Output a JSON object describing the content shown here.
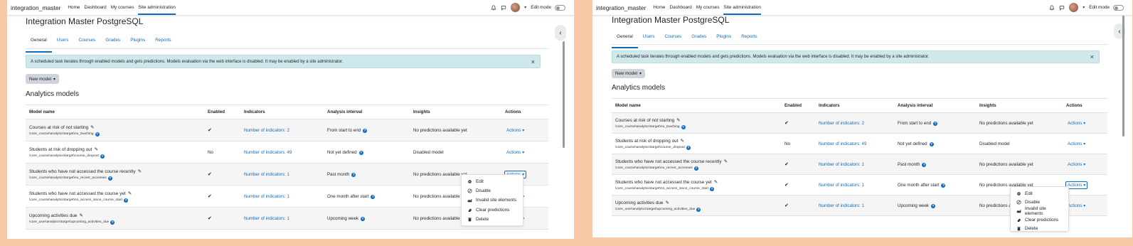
{
  "site_name": "integration_master",
  "nav": [
    "Home",
    "Dashboard",
    "My courses",
    "Site administration"
  ],
  "edit_mode_label": "Edit mode",
  "page_title": "Integration Master PostgreSQL",
  "tabs": [
    "General",
    "Users",
    "Courses",
    "Grades",
    "Plugins",
    "Reports"
  ],
  "alert_text": "A scheduled task iterates through enabled models and gets predictions. Models evaluation via the web interface is disabled. It may be enabled by a site administrator.",
  "alert_close": "×",
  "new_model_label": "New model",
  "section_title": "Analytics models",
  "columns": [
    "Model name",
    "Enabled",
    "Indicators",
    "Analysis interval",
    "Insights",
    "Actions"
  ],
  "models": [
    {
      "name": "Courses at risk of not starting",
      "path": "\\core_course\\analytics\\target\\no_teaching",
      "enabled": "✔",
      "indicators": "Number of indicators: 2",
      "interval": "From start to end",
      "insights": "No predictions available yet",
      "action": "Actions"
    },
    {
      "name": "Students at risk of dropping out",
      "path": "\\core_course\\analytics\\target\\course_dropout",
      "enabled": "No",
      "indicators": "Number of indicators: 49",
      "interval": "Not yet defined",
      "insights": "Disabled model",
      "action": "Actions"
    },
    {
      "name": "Students who have not accessed the course recently",
      "path": "\\core_course\\analytics\\target\\no_recent_accesses",
      "enabled": "✔",
      "indicators": "Number of indicators: 1",
      "interval": "Past month",
      "insights": "No predictions available yet",
      "action": "Actions"
    },
    {
      "name": "Students who have not accessed the course yet",
      "path": "\\core_course\\analytics\\target\\no_access_since_course_start",
      "enabled": "✔",
      "indicators": "Number of indicators: 1",
      "interval": "One month after start",
      "insights": "No predictions available yet",
      "action": "Actions"
    },
    {
      "name": "Upcoming activities due",
      "path": "\\core_user\\analytics\\target\\upcoming_activities_due",
      "enabled": "✔",
      "indicators": "Number of indicators: 1",
      "interval": "Upcoming week",
      "insights": "No predictions available yet",
      "action": "Actions"
    }
  ],
  "dropdown_items": [
    {
      "label": "Edit",
      "icon": "cog-icon"
    },
    {
      "label": "Disable",
      "icon": "block-icon"
    },
    {
      "label": "Invalid site elements",
      "icon": "chart-icon"
    },
    {
      "label": "Clear predictions",
      "icon": "eraser-icon"
    },
    {
      "label": "Delete",
      "icon": "trash-icon"
    }
  ],
  "colors": {
    "accent": "#0f6cbf",
    "alert_bg": "#cfe8eb",
    "background": "#f8c9a6"
  }
}
